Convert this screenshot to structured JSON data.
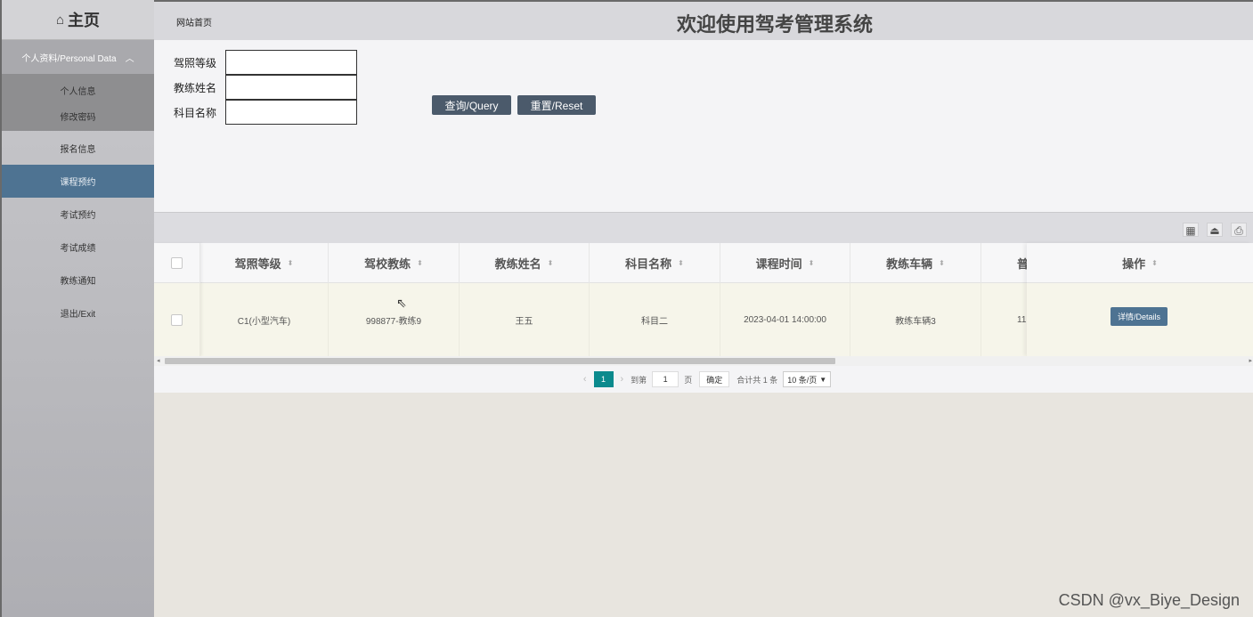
{
  "sidebar": {
    "logo": "主页",
    "group_label": "个人资料/Personal Data",
    "sub_items": [
      "个人信息",
      "修改密码"
    ],
    "items": [
      "报名信息",
      "课程预约",
      "考试预约",
      "考试成绩",
      "教练通知",
      "退出/Exit"
    ],
    "active_index": 1
  },
  "header": {
    "home_link": "网站首页",
    "title": "欢迎使用驾考管理系统"
  },
  "search": {
    "fields": [
      {
        "label": "驾照等级",
        "value": ""
      },
      {
        "label": "教练姓名",
        "value": ""
      },
      {
        "label": "科目名称",
        "value": ""
      }
    ],
    "query_label": "查询/Query",
    "reset_label": "重置/Reset"
  },
  "table": {
    "columns": [
      "驾照等级",
      "驾校教练",
      "教练姓名",
      "科目名称",
      "课程时间",
      "教练车辆",
      "普"
    ],
    "action_column": "操作",
    "rows": [
      {
        "cells": [
          "C1(小型汽车)",
          "998877-教练9",
          "王五",
          "科目二",
          "2023-04-01 14:00:00",
          "教练车辆3",
          "11"
        ],
        "details_label": "详情/Details"
      }
    ]
  },
  "pager": {
    "current_page": "1",
    "goto_label": "到第",
    "goto_value": "1",
    "page_unit": "页",
    "confirm_label": "确定",
    "total_label": "合计共 1 条",
    "page_size": "10 条/页"
  },
  "watermark": "CSDN @vx_Biye_Design"
}
